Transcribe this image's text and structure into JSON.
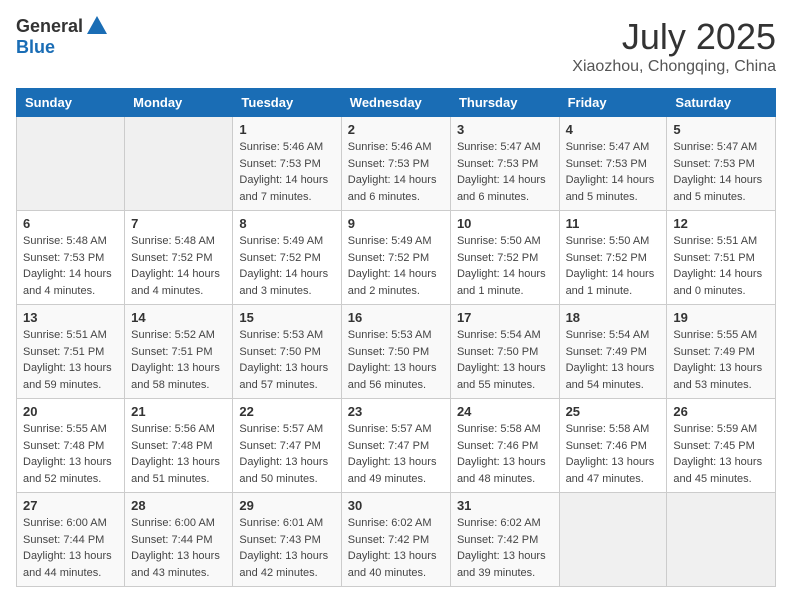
{
  "header": {
    "logo_general": "General",
    "logo_blue": "Blue",
    "month": "July 2025",
    "location": "Xiaozhou, Chongqing, China"
  },
  "weekdays": [
    "Sunday",
    "Monday",
    "Tuesday",
    "Wednesday",
    "Thursday",
    "Friday",
    "Saturday"
  ],
  "weeks": [
    [
      {
        "day": "",
        "info": ""
      },
      {
        "day": "",
        "info": ""
      },
      {
        "day": "1",
        "sunrise": "5:46 AM",
        "sunset": "7:53 PM",
        "daylight": "14 hours and 7 minutes."
      },
      {
        "day": "2",
        "sunrise": "5:46 AM",
        "sunset": "7:53 PM",
        "daylight": "14 hours and 6 minutes."
      },
      {
        "day": "3",
        "sunrise": "5:47 AM",
        "sunset": "7:53 PM",
        "daylight": "14 hours and 6 minutes."
      },
      {
        "day": "4",
        "sunrise": "5:47 AM",
        "sunset": "7:53 PM",
        "daylight": "14 hours and 5 minutes."
      },
      {
        "day": "5",
        "sunrise": "5:47 AM",
        "sunset": "7:53 PM",
        "daylight": "14 hours and 5 minutes."
      }
    ],
    [
      {
        "day": "6",
        "sunrise": "5:48 AM",
        "sunset": "7:53 PM",
        "daylight": "14 hours and 4 minutes."
      },
      {
        "day": "7",
        "sunrise": "5:48 AM",
        "sunset": "7:52 PM",
        "daylight": "14 hours and 4 minutes."
      },
      {
        "day": "8",
        "sunrise": "5:49 AM",
        "sunset": "7:52 PM",
        "daylight": "14 hours and 3 minutes."
      },
      {
        "day": "9",
        "sunrise": "5:49 AM",
        "sunset": "7:52 PM",
        "daylight": "14 hours and 2 minutes."
      },
      {
        "day": "10",
        "sunrise": "5:50 AM",
        "sunset": "7:52 PM",
        "daylight": "14 hours and 1 minute."
      },
      {
        "day": "11",
        "sunrise": "5:50 AM",
        "sunset": "7:52 PM",
        "daylight": "14 hours and 1 minute."
      },
      {
        "day": "12",
        "sunrise": "5:51 AM",
        "sunset": "7:51 PM",
        "daylight": "14 hours and 0 minutes."
      }
    ],
    [
      {
        "day": "13",
        "sunrise": "5:51 AM",
        "sunset": "7:51 PM",
        "daylight": "13 hours and 59 minutes."
      },
      {
        "day": "14",
        "sunrise": "5:52 AM",
        "sunset": "7:51 PM",
        "daylight": "13 hours and 58 minutes."
      },
      {
        "day": "15",
        "sunrise": "5:53 AM",
        "sunset": "7:50 PM",
        "daylight": "13 hours and 57 minutes."
      },
      {
        "day": "16",
        "sunrise": "5:53 AM",
        "sunset": "7:50 PM",
        "daylight": "13 hours and 56 minutes."
      },
      {
        "day": "17",
        "sunrise": "5:54 AM",
        "sunset": "7:50 PM",
        "daylight": "13 hours and 55 minutes."
      },
      {
        "day": "18",
        "sunrise": "5:54 AM",
        "sunset": "7:49 PM",
        "daylight": "13 hours and 54 minutes."
      },
      {
        "day": "19",
        "sunrise": "5:55 AM",
        "sunset": "7:49 PM",
        "daylight": "13 hours and 53 minutes."
      }
    ],
    [
      {
        "day": "20",
        "sunrise": "5:55 AM",
        "sunset": "7:48 PM",
        "daylight": "13 hours and 52 minutes."
      },
      {
        "day": "21",
        "sunrise": "5:56 AM",
        "sunset": "7:48 PM",
        "daylight": "13 hours and 51 minutes."
      },
      {
        "day": "22",
        "sunrise": "5:57 AM",
        "sunset": "7:47 PM",
        "daylight": "13 hours and 50 minutes."
      },
      {
        "day": "23",
        "sunrise": "5:57 AM",
        "sunset": "7:47 PM",
        "daylight": "13 hours and 49 minutes."
      },
      {
        "day": "24",
        "sunrise": "5:58 AM",
        "sunset": "7:46 PM",
        "daylight": "13 hours and 48 minutes."
      },
      {
        "day": "25",
        "sunrise": "5:58 AM",
        "sunset": "7:46 PM",
        "daylight": "13 hours and 47 minutes."
      },
      {
        "day": "26",
        "sunrise": "5:59 AM",
        "sunset": "7:45 PM",
        "daylight": "13 hours and 45 minutes."
      }
    ],
    [
      {
        "day": "27",
        "sunrise": "6:00 AM",
        "sunset": "7:44 PM",
        "daylight": "13 hours and 44 minutes."
      },
      {
        "day": "28",
        "sunrise": "6:00 AM",
        "sunset": "7:44 PM",
        "daylight": "13 hours and 43 minutes."
      },
      {
        "day": "29",
        "sunrise": "6:01 AM",
        "sunset": "7:43 PM",
        "daylight": "13 hours and 42 minutes."
      },
      {
        "day": "30",
        "sunrise": "6:02 AM",
        "sunset": "7:42 PM",
        "daylight": "13 hours and 40 minutes."
      },
      {
        "day": "31",
        "sunrise": "6:02 AM",
        "sunset": "7:42 PM",
        "daylight": "13 hours and 39 minutes."
      },
      {
        "day": "",
        "info": ""
      },
      {
        "day": "",
        "info": ""
      }
    ]
  ]
}
